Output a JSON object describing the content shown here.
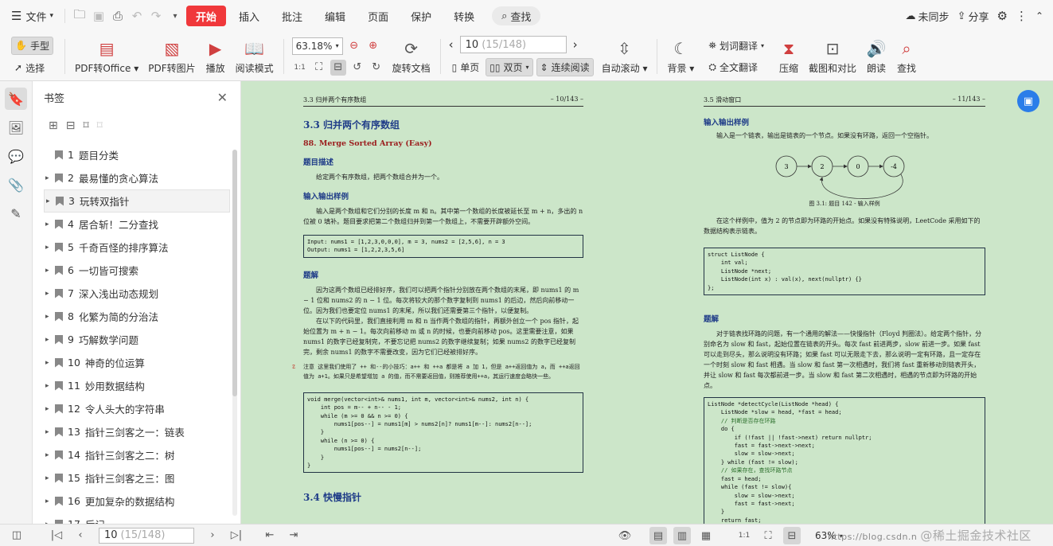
{
  "menubar": {
    "file_label": "文件",
    "tabs": [
      "开始",
      "插入",
      "批注",
      "编辑",
      "页面",
      "保护",
      "转换"
    ],
    "search_label": "查找",
    "sync_label": "未同步",
    "share_label": "分享"
  },
  "toolbar": {
    "hand_label": "手型",
    "select_label": "选择",
    "pdf_office_label": "PDF转Office",
    "pdf_image_label": "PDF转图片",
    "play_label": "播放",
    "read_mode_label": "阅读模式",
    "zoom_value": "63.18%",
    "rotate_label": "旋转文档",
    "page_current": "10",
    "page_total": "(15/148)",
    "single_label": "单页",
    "double_label": "双页",
    "continuous_label": "连续阅读",
    "auto_scroll_label": "自动滚动",
    "background_label": "背景",
    "word_translate_label": "划词翻译",
    "full_translate_label": "全文翻译",
    "compress_label": "压缩",
    "compare_label": "截图和对比",
    "read_aloud_label": "朗读",
    "find_label": "查找"
  },
  "sidebar": {
    "title": "书签",
    "items": [
      {
        "num": "1",
        "label": "题目分类"
      },
      {
        "num": "2",
        "label": "最易懂的贪心算法"
      },
      {
        "num": "3",
        "label": "玩转双指针"
      },
      {
        "num": "4",
        "label": "居合斩！二分查找"
      },
      {
        "num": "5",
        "label": "千奇百怪的排序算法"
      },
      {
        "num": "6",
        "label": "一切皆可搜索"
      },
      {
        "num": "7",
        "label": "深入浅出动态规划"
      },
      {
        "num": "8",
        "label": "化繁为简的分治法"
      },
      {
        "num": "9",
        "label": "巧解数学问题"
      },
      {
        "num": "10",
        "label": "神奇的位运算"
      },
      {
        "num": "11",
        "label": "妙用数据结构"
      },
      {
        "num": "12",
        "label": "令人头大的字符串"
      },
      {
        "num": "13",
        "label": "指针三剑客之一：链表"
      },
      {
        "num": "14",
        "label": "指针三剑客之二：树"
      },
      {
        "num": "15",
        "label": "指针三剑客之三：图"
      },
      {
        "num": "16",
        "label": "更加复杂的数据结构"
      },
      {
        "num": "17",
        "label": "后记"
      }
    ]
  },
  "doc": {
    "left": {
      "header_left": "3.3 归并两个有序数组",
      "header_right": "– 10/143 –",
      "section_title": "3.3 归并两个有序数组",
      "problem_title": "88. Merge Sorted Array (Easy)",
      "desc_heading": "题目描述",
      "desc_text": "给定两个有序数组，把两个数组合并为一个。",
      "io_heading": "输入输出样例",
      "io_text": "输入是两个数组和它们分别的长度 m 和 n。其中第一个数组的长度被延长至 m + n，多出的 n 位被 0 填补。题目要求把第二个数组归并到第一个数组上，不需要开辟额外空间。",
      "code1": "Input: nums1 = [1,2,3,0,0,0], m = 3, nums2 = [2,5,6], n = 3\nOutput: nums1 = [1,2,2,3,5,6]",
      "solution_heading": "题解",
      "sol_p1": "因为这两个数组已经排好序，我们可以把两个指针分别放在两个数组的末尾，即 nums1 的 m − 1 位和 nums2 的 n − 1 位。每次将较大的那个数字复制到 nums1 的后边，然后向前移动一位。因为我们也要定位 nums1 的末尾，所以我们还需要第三个指针，以便复制。",
      "sol_p2": "在以下的代码里，我们直接利用 m 和 n 当作两个数组的指针，再额外创立一个 pos 指针，起始位置为 m + n − 1。每次向前移动 m 或 n 的时候，也要向前移动 pos。这里需要注意，如果 nums1 的数字已经复制完，不要忘记把 nums2 的数字继续复制；如果 nums2 的数字已经复制完，剩余 nums1 的数字不需要改变，因为它们已经被排好序。",
      "note": "注意 这里我们使用了 ++ 和--的小技巧：a++ 和 ++a 都是将 a 加 1，但是 a++返回值为 a，而 ++a返回值为 a+1。如果只是希望增加 a 的值，而不需要返回值，则推荐使用++a，其运行速度会略快一些。",
      "code2_l1": "void merge(vector<int>& nums1, int m, vector<int>& nums2, int n) {",
      "code2_l2": "    int pos = m-- + n-- - 1;",
      "code2_l3": "    while (m >= 0 && n >= 0) {",
      "code2_l4": "        nums1[pos--] = nums1[m] > nums2[n]? nums1[m--]: nums2[n--];",
      "code2_l5": "    }",
      "code2_l6": "    while (n >= 0) {",
      "code2_l7": "        nums1[pos--] = nums2[n--];",
      "code2_l8": "    }",
      "code2_l9": "}",
      "next_section": "3.4 快慢指针"
    },
    "right": {
      "header_left": "3.5 滑动窗口",
      "header_right": "– 11/143 –",
      "io_heading": "输入输出样例",
      "io_text": "输入是一个链表，输出是链表的一个节点。如果没有环路，返回一个空指针。",
      "nodes": [
        "3",
        "2",
        "0",
        "-4"
      ],
      "figure_caption": "图 3.1: 题目 142 - 输入样例",
      "example_text": "在这个样例中，值为 2 的节点即为环路的开始点。如果没有特殊说明，LeetCode 采用如下的数据结构表示链表。",
      "struct_l1": "struct ListNode {",
      "struct_l2": "    int val;",
      "struct_l3": "    ListNode *next;",
      "struct_l4": "    ListNode(int x) : val(x), next(nullptr) {}",
      "struct_l5": "};",
      "solution_heading": "题解",
      "sol_text": "对于链表找环路的问题，有一个通用的解法——快慢指针（Floyd 判圈法）。给定两个指针，分别命名为 slow 和 fast，起始位置在链表的开头。每次 fast 前进两步，slow 前进一步。如果 fast 可以走到尽头，那么说明没有环路；如果 fast 可以无限走下去，那么说明一定有环路，且一定存在一个时刻 slow 和 fast 相遇。当 slow 和 fast 第一次相遇时，我们将 fast 重新移动到链表开头，并让 slow 和 fast 每次都前进一步。当 slow 和 fast 第二次相遇时，相遇的节点即为环路的开始点。",
      "code": [
        "ListNode *detectCycle(ListNode *head) {",
        "    ListNode *slow = head, *fast = head;",
        "    // 判断是否存在环路",
        "    do {",
        "        if (!fast || !fast->next) return nullptr;",
        "        fast = fast->next->next;",
        "        slow = slow->next;",
        "    } while (fast != slow);",
        "    // 如果存在，查找环路节点",
        "    fast = head;",
        "    while (fast != slow){",
        "        slow = slow->next;",
        "        fast = fast->next;",
        "    }",
        "    return fast;",
        "}"
      ]
    }
  },
  "status": {
    "page_current": "10",
    "page_total": "(15/148)",
    "zoom": "63%",
    "watermark_url": "https://blog.csdn.n",
    "watermark_brand": "@稀土掘金技术社区"
  },
  "colors": {
    "accent": "#f0383b",
    "doc_bg": "#cce6c9",
    "heading": "#1f3c88",
    "fab": "#2b7de9"
  }
}
